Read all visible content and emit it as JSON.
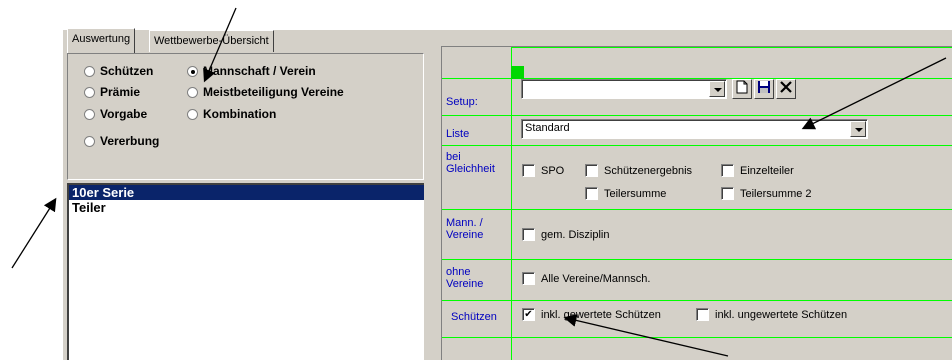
{
  "tabs": [
    {
      "label": "Auswertung",
      "active": true
    },
    {
      "label": "Wettbewerbe-Übersicht",
      "active": false
    }
  ],
  "radio_options": [
    {
      "label": "Schützen",
      "checked": false
    },
    {
      "label": "Mannschaft / Verein",
      "checked": true
    },
    {
      "label": "Prämie",
      "checked": false
    },
    {
      "label": "Meistbeteiligung Vereine",
      "checked": false
    },
    {
      "label": "Vorgabe",
      "checked": false
    },
    {
      "label": "Kombination",
      "checked": false
    },
    {
      "label": "Vererbung",
      "checked": false
    }
  ],
  "list_items": [
    {
      "label": "10er Serie",
      "selected": true
    },
    {
      "label": "Teiler",
      "selected": false
    }
  ],
  "settings": {
    "setup_label": "Setup:",
    "setup_value": "",
    "liste_label": "Liste",
    "liste_value": "Standard",
    "gleichheit_label": "bei Gleichheit",
    "mannschaft_label": "Mann. / Vereine",
    "ohne_label": "ohne Vereine",
    "schuetzen_label": "Schützen"
  },
  "checkboxes": {
    "spo": {
      "label": "SPO",
      "checked": false
    },
    "schuetzenergebnis": {
      "label": "Schützenergebnis",
      "checked": false
    },
    "einzelteiler": {
      "label": "Einzelteiler",
      "checked": false
    },
    "teilersumme": {
      "label": "Teilersumme",
      "checked": false
    },
    "teilersumme2": {
      "label": "Teilersumme 2",
      "checked": false
    },
    "gem_disziplin": {
      "label": "gem. Disziplin",
      "checked": false
    },
    "alle_vereine": {
      "label": "Alle Vereine/Mannsch.",
      "checked": false
    },
    "inkl_gewertete": {
      "label": "inkl. gewertete Schützen",
      "checked": true
    },
    "inkl_ungewertete": {
      "label": "inkl. ungewertete Schützen",
      "checked": false
    }
  },
  "toolbar_icons": [
    "new-document-icon",
    "save-disk-icon",
    "delete-x-icon"
  ],
  "colors": {
    "window_face": "#d4d0c8",
    "grid_green": "#00ff00",
    "selection_blue": "#0a246a",
    "label_blue": "#0000c0"
  }
}
